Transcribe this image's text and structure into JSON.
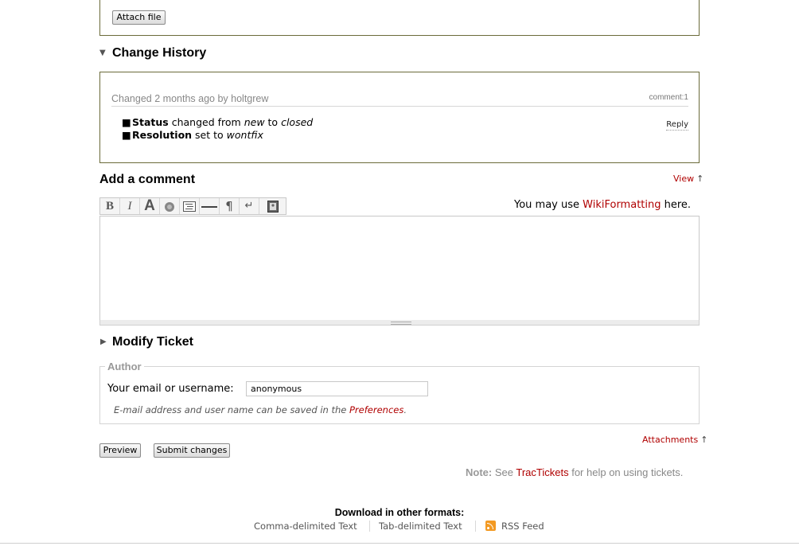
{
  "attachments": {
    "attach_button": "Attach file"
  },
  "change_history": {
    "title": "Change History",
    "entry": {
      "changed_prefix": "Changed",
      "age": "2 months ago",
      "by_word": "by",
      "author": "holtgrew",
      "comment_ref": "comment:1",
      "reply": "Reply",
      "changes": [
        {
          "field": "Status",
          "verb": "changed from",
          "from": "new",
          "to_word": "to",
          "to": "closed"
        },
        {
          "field": "Resolution",
          "verb": "set to",
          "to": "wontfix"
        }
      ]
    }
  },
  "comment": {
    "title": "Add a comment",
    "view_link": "View",
    "arrow": "↑",
    "hint_prefix": "You may use",
    "hint_link": "WikiFormatting",
    "hint_suffix": "here.",
    "value": "",
    "toolbar": [
      "bold-icon",
      "italic-icon",
      "heading-icon",
      "link-icon",
      "code-block-icon",
      "horizontal-rule-icon",
      "paragraph-icon",
      "line-break-icon",
      "image-icon"
    ]
  },
  "modify": {
    "title": "Modify Ticket"
  },
  "author": {
    "legend": "Author",
    "label": "Your email or username:",
    "value": "anonymous",
    "hint_text": "E-mail address and user name can be saved in the",
    "hint_link": "Preferences",
    "hint_end": "."
  },
  "attachments_link": "Attachments",
  "buttons": {
    "preview": "Preview",
    "submit": "Submit changes"
  },
  "note": {
    "label": "Note:",
    "see": "See",
    "link": "TracTickets",
    "rest": "for help on using tickets."
  },
  "download": {
    "title": "Download in other formats:",
    "formats": [
      "Comma-delimited Text",
      "Tab-delimited Text",
      "RSS Feed"
    ]
  },
  "colors": {
    "link": "#b00000",
    "box_border": "#6b6b3a"
  }
}
